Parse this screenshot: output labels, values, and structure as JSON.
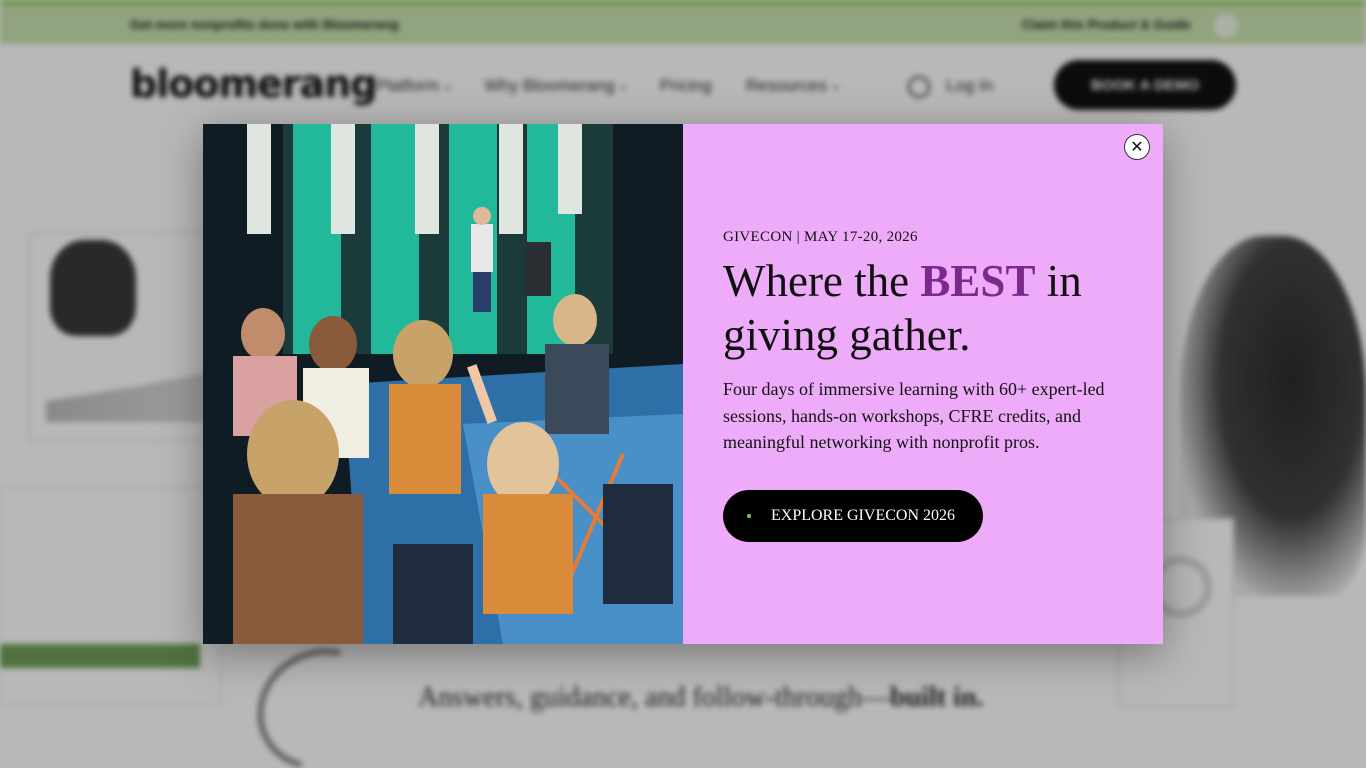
{
  "background_page": {
    "announcement": {
      "text": "Get more nonprofits done with Bloomerang",
      "cta": "Claim this Product & Guide"
    },
    "header": {
      "logo": "bloomerang",
      "nav": [
        {
          "label": "Platform"
        },
        {
          "label": "Why Bloomerang"
        },
        {
          "label": "Pricing"
        },
        {
          "label": "Resources"
        }
      ],
      "login": "Log In",
      "book_demo": "BOOK A DEMO"
    },
    "subtagline": {
      "text": "Answers, guidance, and follow-through—",
      "bold": "built in."
    }
  },
  "modal": {
    "photo_alt": "Conference attendees raising hands during a presentation",
    "eyebrow": "GIVECON | MAY 17-20, 2026",
    "headline_pre": "Where the ",
    "headline_accent": "BEST",
    "headline_post": " in giving gather.",
    "description": "Four days of immersive learning with 60+ expert-led sessions, hands-on workshops, CFRE credits, and meaningful networking with nonprofit pros.",
    "cta_label": "EXPLORE GIVECON 2026",
    "close_label": "✕",
    "colors": {
      "panel_bg": "#eeabf9",
      "accent": "#7b2a8c",
      "cta_bg": "#000000",
      "cta_dot": "#7fc64a"
    }
  }
}
